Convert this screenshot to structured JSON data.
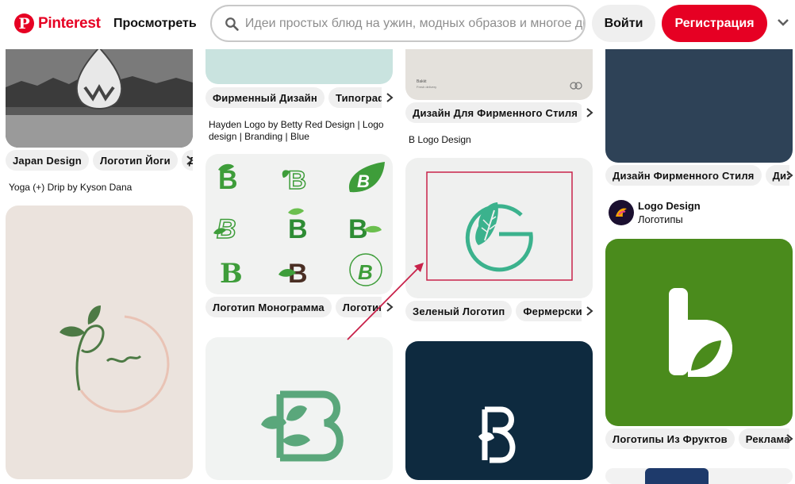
{
  "header": {
    "brand": "Pinterest",
    "browse": "Просмотреть",
    "search_placeholder": "Идеи простых блюд на ужин, модных образов и многое другое",
    "login": "Войти",
    "signup": "Регистрация"
  },
  "colors": {
    "brand": "#e60023",
    "chip_bg": "#efefef",
    "annotation": "#c8224a"
  },
  "icons": [
    "pinterest-logo-icon",
    "search-icon",
    "chevron-down-icon",
    "chevron-right-icon",
    "arrow-annotation-icon"
  ],
  "col1": {
    "pin1": {
      "chips": [
        "Japan Design",
        "Логотип Йоги",
        "Д"
      ],
      "title": "Yoga (+) Drip by Kyson Dana"
    }
  },
  "col2": {
    "pin1": {
      "chips": [
        "Фирменный Дизайн",
        "Типографика"
      ],
      "title": "Hayden Logo by Betty Red Design | Logo design | Branding | Blue"
    },
    "pin2": {
      "chips": [
        "Логотип Монограмма",
        "Логотип"
      ]
    }
  },
  "col3": {
    "pin1": {
      "chips": [
        "Дизайн Для Фирменного Стиля"
      ],
      "title": "B Logo Design",
      "mock_text_1": "Bakkt",
      "mock_text_2": "Fresh delivery"
    },
    "pin2": {
      "chips": [
        "Зеленый Логотип",
        "Фермерский"
      ]
    }
  },
  "col4": {
    "pin1": {
      "chips": [
        "Дизайн Фирменного Стиля",
        "Дизайн"
      ]
    },
    "board": {
      "name": "Logo Design",
      "subtitle": "Логотипы"
    },
    "pin2": {
      "chips": [
        "Логотипы Из Фруктов",
        "Реклама"
      ]
    }
  }
}
